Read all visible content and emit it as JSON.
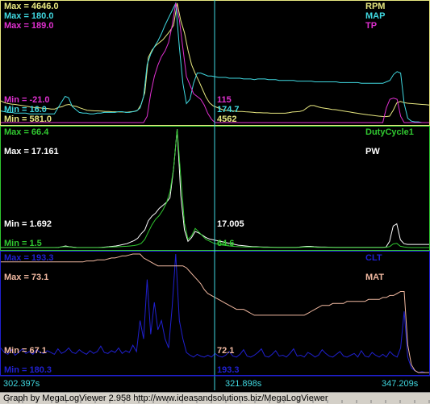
{
  "colors": {
    "rpm": "#e8e880",
    "map": "#40d8e0",
    "tp": "#e030d0",
    "pw": "#ffffff",
    "duty": "#30c830",
    "clt": "#2020d0",
    "mat": "#f0b8a0",
    "frame1": "#e8e880",
    "frame2": "#30c830",
    "frame3": "#2020d0",
    "cursor": "#40d8e0",
    "time": "#40d8e0",
    "timeline": "#2020d0"
  },
  "footer": {
    "text": "Graph by MegaLogViewer 2.958 http://www.ideasandsolutions.biz/MegaLogViewer"
  },
  "cursor": {
    "time": "321.898s",
    "rpm_value": "4562",
    "map_value": "174.7",
    "tp_value": "115",
    "pw_value": "17.005",
    "duty_value": "64.6",
    "mat_value": "72.1",
    "clt_value": "193.3"
  },
  "chart_data": [
    {
      "type": "line",
      "panel": "top",
      "x": [
        302.397,
        347.209
      ],
      "series": [
        {
          "name": "RPM",
          "max_label": "Max = 4646.0",
          "min_label": "Min = 581.0",
          "max": 4646.0,
          "min": 581.0,
          "color_key": "rpm",
          "values": [
            1320,
            1260,
            1230,
            1210,
            1200,
            1180,
            1160,
            1140,
            1120,
            1100,
            1080,
            1080,
            1060,
            1060,
            1040,
            1040,
            1100,
            1120,
            1180,
            1200,
            1150,
            1130,
            1080,
            1040,
            1000,
            990,
            980,
            980,
            970,
            960,
            960,
            950,
            950,
            940,
            940,
            930,
            950,
            960,
            1000,
            1200,
            1600,
            2800,
            3050,
            3200,
            3300,
            3400,
            3550,
            3700,
            3900,
            4646,
            4050,
            3650,
            3050,
            2550,
            2250,
            2000,
            1720,
            1450,
            1250,
            1150,
            1100,
            1050,
            1000,
            990,
            980,
            970,
            960,
            960,
            950,
            940,
            930,
            920,
            920,
            910,
            910,
            900,
            900,
            900,
            900,
            900,
            920,
            940,
            950,
            960,
            990,
            1080,
            1160,
            1160,
            1120,
            1090,
            1070,
            1050,
            1030,
            1020,
            1000,
            980,
            960,
            940,
            920,
            900,
            880,
            860,
            845,
            830,
            815,
            800,
            790,
            785,
            800,
            1000,
            1250,
            1300,
            1260,
            1240,
            1230,
            1220,
            1210,
            1200,
            1190,
            1180
          ]
        },
        {
          "name": "MAP",
          "max_label": "Max = 180.0",
          "min_label": "Min = 16.0",
          "max": 180.0,
          "min": 16.0,
          "color_key": "map",
          "values": [
            32,
            31,
            30,
            30,
            29,
            29,
            29,
            29,
            28,
            28,
            28,
            28,
            28,
            28,
            28,
            28,
            36,
            44,
            52,
            50,
            38,
            34,
            30,
            29,
            29,
            28,
            28,
            29,
            29,
            30,
            30,
            30,
            30,
            31,
            31,
            30,
            30,
            31,
            32,
            36,
            52,
            96,
            110,
            120,
            128,
            138,
            150,
            160,
            170,
            180,
            120,
            70,
            42,
            48,
            70,
            84,
            84,
            82,
            80,
            80,
            79,
            78,
            78,
            78,
            77,
            77,
            77,
            77,
            76,
            76,
            76,
            75,
            76,
            76,
            76,
            75,
            75,
            75,
            74,
            74,
            74,
            74,
            74,
            73,
            73,
            73,
            73,
            73,
            72,
            72,
            72,
            72,
            72,
            72,
            72,
            71,
            71,
            71,
            71,
            71,
            71,
            70,
            70,
            70,
            70,
            70,
            70,
            70,
            72,
            74,
            82,
            86,
            84,
            42,
            22,
            18,
            17,
            17,
            16,
            16,
            16
          ]
        },
        {
          "name": "TP",
          "max_label": "Max = 189.0",
          "min_label": "Min = -21.0",
          "max": 189.0,
          "min": -21.0,
          "color_key": "tp",
          "values": [
            -21,
            -21,
            -21,
            -21,
            -21,
            -21,
            -21,
            -21,
            -21,
            -21,
            -21,
            -21,
            -21,
            -21,
            -21,
            -21,
            -21,
            -21,
            -21,
            -21,
            -21,
            -21,
            -21,
            -21,
            -21,
            -21,
            -21,
            -21,
            -21,
            -21,
            -21,
            -21,
            -21,
            -21,
            -21,
            -21,
            -21,
            -21,
            -21,
            -21,
            -21,
            -10,
            30,
            60,
            80,
            95,
            105,
            120,
            150,
            189,
            160,
            110,
            60,
            45,
            30,
            25,
            20,
            10,
            -5,
            -15,
            -21,
            -21,
            -21,
            -21,
            -21,
            -21,
            -21,
            -21,
            -21,
            -21,
            -21,
            -21,
            -21,
            -21,
            -21,
            -21,
            -21,
            -21,
            -21,
            -21,
            -21,
            -21,
            -21,
            -21,
            -21,
            -21,
            -21,
            -21,
            -21,
            -21,
            -21,
            -21,
            -21,
            -21,
            -21,
            -21,
            -21,
            -21,
            -21,
            -21,
            -21,
            -21,
            -21,
            -21,
            -21,
            -21,
            -21,
            -21,
            5,
            20,
            22,
            20,
            -10,
            -21,
            -21,
            -21,
            -21,
            -21,
            -21,
            -21,
            -21
          ]
        }
      ]
    },
    {
      "type": "line",
      "panel": "middle",
      "x": [
        302.397,
        347.209
      ],
      "series": [
        {
          "name": "PW",
          "max_label": "Max = 17.161",
          "min_label": "Min = 1.692",
          "max": 17.161,
          "min": 1.692,
          "color_key": "pw",
          "values": [
            1.7,
            1.7,
            1.7,
            1.7,
            1.7,
            1.7,
            1.7,
            1.7,
            1.7,
            1.7,
            1.7,
            1.7,
            1.7,
            1.7,
            1.7,
            1.7,
            1.72,
            1.8,
            1.9,
            1.8,
            1.75,
            1.72,
            1.7,
            1.7,
            1.7,
            1.7,
            1.7,
            1.7,
            1.72,
            1.75,
            1.8,
            1.85,
            1.9,
            2.0,
            2.1,
            2.2,
            2.4,
            2.6,
            2.9,
            3.5,
            4.0,
            5.2,
            5.8,
            6.2,
            6.8,
            7.2,
            7.6,
            8.2,
            12.0,
            17.16,
            8.5,
            4.0,
            2.5,
            3.0,
            3.8,
            3.6,
            3.3,
            3.0,
            2.8,
            2.7,
            2.6,
            2.5,
            2.4,
            2.3,
            2.2,
            2.1,
            2.0,
            1.95,
            1.9,
            1.85,
            1.8,
            1.8,
            1.78,
            1.76,
            1.75,
            1.74,
            1.73,
            1.72,
            1.72,
            1.72,
            1.72,
            1.72,
            1.72,
            1.75,
            1.8,
            1.85,
            1.85,
            1.8,
            1.78,
            1.76,
            1.75,
            1.74,
            1.73,
            1.72,
            1.72,
            1.72,
            1.72,
            1.72,
            1.72,
            1.72,
            1.72,
            1.72,
            1.72,
            1.72,
            1.72,
            1.72,
            1.72,
            1.75,
            2.5,
            4.5,
            4.8,
            2.7,
            2.2,
            2.1,
            2.1,
            2.1,
            2.1,
            2.1,
            2.1,
            2.1
          ]
        },
        {
          "name": "DutyCycle1",
          "max_label": "Max = 66.4",
          "min_label": "Min = 1.5",
          "max": 66.4,
          "min": 1.5,
          "color_key": "duty",
          "values": [
            1.5,
            1.5,
            1.5,
            1.5,
            1.5,
            1.5,
            1.5,
            1.5,
            1.5,
            1.5,
            1.5,
            1.5,
            1.5,
            1.5,
            1.5,
            1.5,
            1.6,
            1.8,
            2.0,
            1.8,
            1.6,
            1.5,
            1.5,
            1.5,
            1.5,
            1.5,
            1.5,
            1.5,
            1.5,
            1.6,
            1.7,
            1.8,
            1.9,
            2.0,
            2.1,
            2.2,
            2.4,
            2.6,
            3.0,
            3.8,
            6.0,
            10.0,
            14.0,
            17.0,
            19.0,
            22.0,
            26.0,
            32.0,
            45.0,
            66.4,
            40.0,
            15.0,
            6.0,
            8.0,
            12.0,
            10.0,
            8.0,
            6.0,
            5.0,
            4.0,
            3.5,
            3.0,
            2.8,
            2.5,
            2.3,
            2.1,
            2.0,
            1.9,
            1.8,
            1.8,
            1.7,
            1.7,
            1.7,
            1.6,
            1.6,
            1.6,
            1.6,
            1.6,
            1.6,
            1.6,
            1.6,
            1.6,
            1.6,
            1.6,
            1.7,
            1.8,
            1.8,
            1.7,
            1.6,
            1.6,
            1.6,
            1.6,
            1.6,
            1.6,
            1.6,
            1.6,
            1.6,
            1.6,
            1.6,
            1.6,
            1.6,
            1.6,
            1.6,
            1.6,
            1.6,
            1.6,
            1.6,
            1.6,
            2.0,
            3.5,
            3.8,
            2.2,
            1.8,
            1.6,
            1.5,
            1.5,
            1.5,
            1.5,
            1.5,
            1.5
          ]
        }
      ]
    },
    {
      "type": "line",
      "panel": "bottom",
      "x": [
        302.397,
        347.209
      ],
      "series": [
        {
          "name": "CLT",
          "max_label": "Max = 193.3",
          "min_label": "Min = 180.3",
          "max": 193.3,
          "min": 180.3,
          "color_key": "clt",
          "values": [
            183.0,
            182.5,
            182.3,
            182.8,
            182.2,
            182.5,
            182.9,
            182.4,
            182.6,
            182.3,
            182.8,
            182.5,
            182.4,
            182.7,
            182.5,
            182.3,
            182.9,
            182.4,
            182.6,
            183.0,
            182.5,
            182.4,
            182.8,
            182.5,
            182.3,
            182.7,
            182.4,
            182.6,
            183.2,
            182.5,
            182.4,
            182.7,
            182.5,
            183.0,
            182.4,
            182.7,
            182.5,
            183.3,
            182.6,
            186.0,
            184.0,
            190.5,
            184.5,
            188.0,
            185.0,
            186.0,
            184.0,
            183.0,
            187.5,
            193.3,
            186.0,
            184.0,
            182.5,
            182.2,
            182.0,
            182.3,
            182.1,
            182.0,
            182.2,
            182.0,
            182.4,
            182.1,
            182.0,
            182.2,
            182.6,
            182.1,
            182.0,
            182.3,
            182.8,
            182.1,
            182.0,
            182.2,
            182.5,
            182.9,
            182.1,
            182.0,
            182.3,
            182.7,
            182.1,
            182.2,
            182.0,
            182.4,
            182.9,
            182.1,
            182.2,
            182.0,
            182.5,
            182.3,
            182.0,
            182.2,
            182.8,
            182.4,
            182.1,
            182.0,
            182.3,
            182.6,
            182.1,
            182.0,
            182.2,
            182.4,
            182.0,
            182.7,
            182.1,
            182.0,
            182.5,
            182.2,
            182.0,
            182.3,
            182.0,
            182.6,
            182.2,
            182.0,
            183.0,
            187.0,
            182.0,
            180.8,
            180.5,
            180.3,
            180.4,
            180.3,
            180.3
          ]
        },
        {
          "name": "MAT",
          "max_label": "Max = 73.1",
          "min_label": "Min = 67.1",
          "max": 73.1,
          "min": 67.1,
          "color_key": "mat",
          "values": [
            72.7,
            72.7,
            72.7,
            72.7,
            72.7,
            72.7,
            72.7,
            72.7,
            72.7,
            72.7,
            72.7,
            72.7,
            72.7,
            72.7,
            72.7,
            72.7,
            72.7,
            72.7,
            72.7,
            72.7,
            72.7,
            72.7,
            72.7,
            72.7,
            72.75,
            72.75,
            72.75,
            72.8,
            72.8,
            72.8,
            72.85,
            72.9,
            72.9,
            72.95,
            73.0,
            73.0,
            73.05,
            73.1,
            73.1,
            73.1,
            72.9,
            72.8,
            72.7,
            72.6,
            72.5,
            72.5,
            72.5,
            72.5,
            72.5,
            72.5,
            72.5,
            72.5,
            72.4,
            72.2,
            72.0,
            71.8,
            71.6,
            71.3,
            71.1,
            71.0,
            70.9,
            70.8,
            70.7,
            70.6,
            70.5,
            70.4,
            70.3,
            70.3,
            70.3,
            70.2,
            70.1,
            70.0,
            70.0,
            70.0,
            70.0,
            70.0,
            70.0,
            70.0,
            70.0,
            70.0,
            70.0,
            70.0,
            70.0,
            70.0,
            70.0,
            70.0,
            70.1,
            70.2,
            70.3,
            70.4,
            70.5,
            70.5,
            70.5,
            70.6,
            70.6,
            70.6,
            70.6,
            70.7,
            70.7,
            70.7,
            70.7,
            70.7,
            70.7,
            70.8,
            70.8,
            70.8,
            70.8,
            70.9,
            70.9,
            71.0,
            71.0,
            71.1,
            71.2,
            71.2,
            68.5,
            67.5,
            67.2,
            67.1,
            67.1,
            67.1,
            67.1
          ]
        }
      ]
    }
  ],
  "timeline": {
    "start": "302.397s",
    "mid": "321.898s",
    "end": "347.209s"
  }
}
